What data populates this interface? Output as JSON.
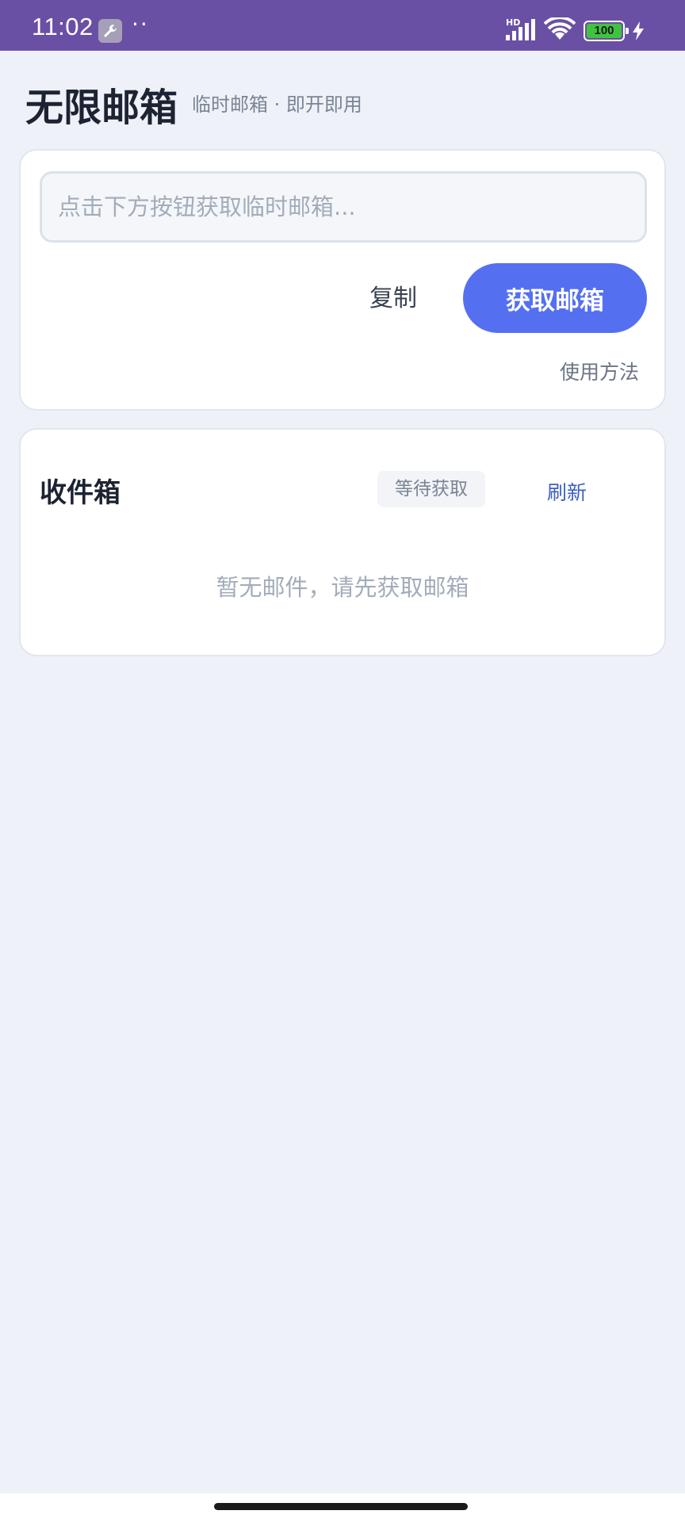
{
  "status_bar": {
    "time": "11:02",
    "dots": "··",
    "network": "HD",
    "battery": "100",
    "icons": [
      "wrench-icon",
      "signal-icon",
      "wifi-icon",
      "battery-icon",
      "charging-bolt-icon"
    ]
  },
  "header": {
    "title": "无限邮箱",
    "subtitle": "临时邮箱 · 即开即用"
  },
  "email_card": {
    "input_value": "",
    "input_placeholder": "点击下方按钮获取临时邮箱...",
    "copy_label": "复制",
    "get_label": "获取邮箱",
    "howto_label": "使用方法"
  },
  "inbox": {
    "title": "收件箱",
    "status": "等待获取",
    "refresh_label": "刷新",
    "empty_text": "暂无邮件，请先获取邮箱"
  },
  "colors": {
    "status_bar": "#6a50a4",
    "background": "#eef2f8",
    "primary_button": "#5470f0",
    "link": "#3d5fc4"
  }
}
